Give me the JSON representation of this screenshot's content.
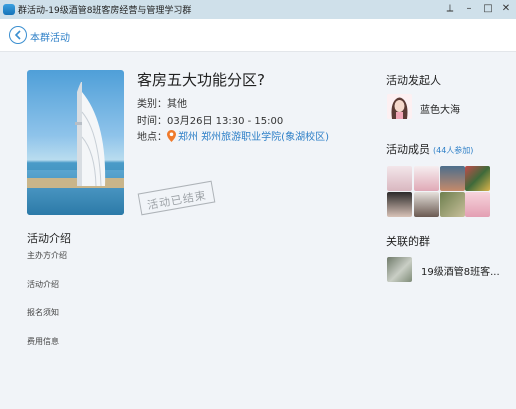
{
  "window": {
    "title": "群活动-19级酒管8班客房经营与管理学习群",
    "controls": [
      "pin-icon",
      "minimize-icon",
      "maximize-icon",
      "close-icon"
    ]
  },
  "nav": {
    "back_label": "本群活动"
  },
  "event": {
    "title": "客房五大功能分区?",
    "category_label": "类别：",
    "category_value": "其他",
    "time_label": "时间：",
    "time_value": "03月26日 13:30 - 15:00",
    "location_label": "地点：",
    "location_value": "郑州 郑州旅游职业学院(象湖校区)",
    "status_stamp": "活动已结束"
  },
  "intro": {
    "heading": "活动介绍",
    "items": [
      "主办方介绍",
      "活动介绍",
      "报名须知",
      "费用信息"
    ]
  },
  "sidebar": {
    "organizer_heading": "活动发起人",
    "organizer_name": "蓝色大海",
    "members_heading": "活动成员",
    "members_count": "(44人参加)",
    "linked_heading": "关联的群",
    "linked_group_name": "19级酒管8班客..."
  },
  "colors": {
    "accent": "#2d7fc7",
    "titlebar": "#cfe0ea",
    "background": "#f1f4f8",
    "stamp": "#9ea3a8",
    "location_pin": "#f07a2b"
  }
}
